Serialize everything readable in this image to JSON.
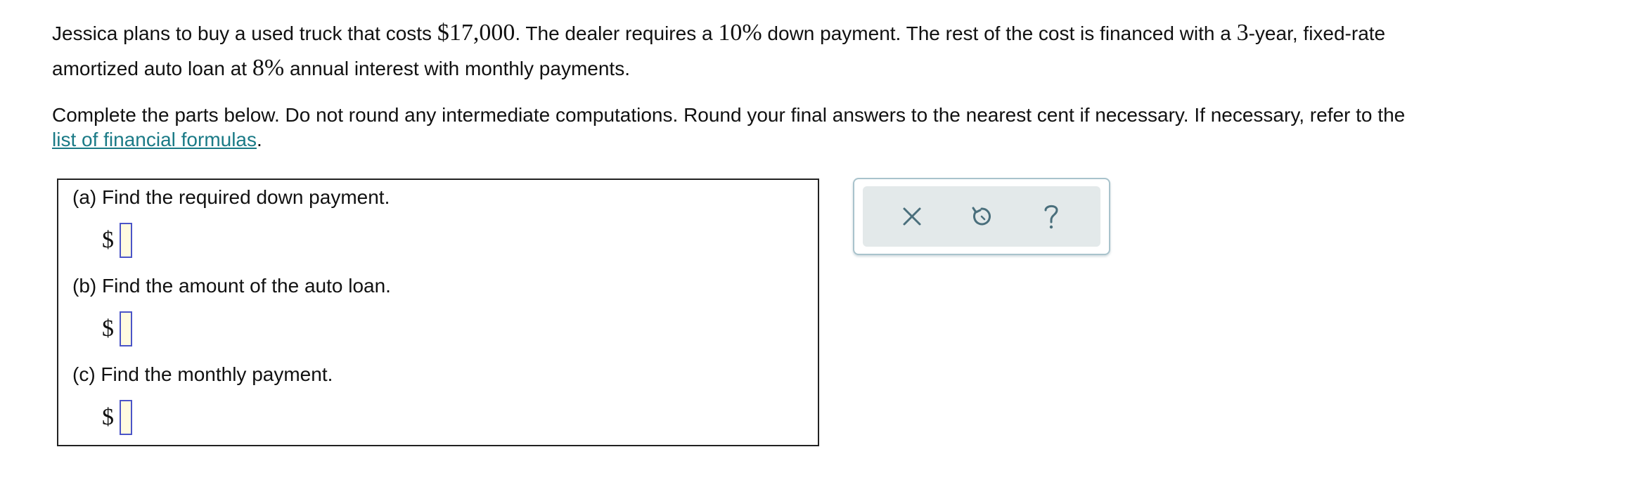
{
  "problem": {
    "line1_a": "Jessica plans to buy a used truck that costs ",
    "cost": "$17,000",
    "line1_b": ". The dealer requires a ",
    "down_pct": "10%",
    "line1_c": " down payment. The rest of the cost is financed with a ",
    "years": "3",
    "line1_d": "-year, fixed-rate",
    "line2_a": "amortized auto loan at ",
    "rate": "8%",
    "line2_b": " annual interest with monthly payments."
  },
  "instructions": {
    "text": "Complete the parts below. Do not round any intermediate computations. Round your final answers to the nearest cent if necessary. If necessary, refer to the",
    "link_label": "list of financial formulas",
    "after_link": "."
  },
  "parts": [
    {
      "label": "(a) Find the required down payment.",
      "currency": "$",
      "value": ""
    },
    {
      "label": "(b) Find the amount of the auto loan.",
      "currency": "$",
      "value": ""
    },
    {
      "label": "(c) Find the monthly payment.",
      "currency": "$",
      "value": ""
    }
  ],
  "toolbar": {
    "clear_icon": "close-icon",
    "undo_icon": "undo-icon",
    "help_icon": "help-icon",
    "icon_color": "#4a6f7c"
  }
}
